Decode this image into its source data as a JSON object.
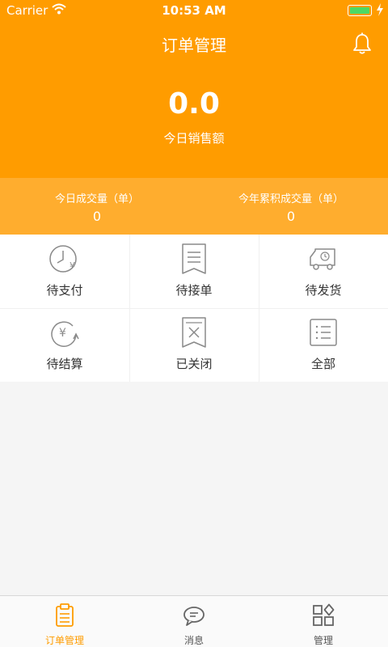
{
  "status_bar": {
    "carrier": "Carrier",
    "time": "10:53 AM"
  },
  "header": {
    "title": "订单管理",
    "amount": "0.0",
    "amount_label": "今日销售额"
  },
  "stats": {
    "today": {
      "label": "今日成交量（单）",
      "value": "0"
    },
    "year": {
      "label": "今年累积成交量（单）",
      "value": "0"
    }
  },
  "grid": {
    "items": [
      {
        "label": "待支付",
        "icon": "clock-yen-icon"
      },
      {
        "label": "待接单",
        "icon": "receipt-icon"
      },
      {
        "label": "待发货",
        "icon": "truck-icon"
      },
      {
        "label": "待结算",
        "icon": "yen-refresh-icon"
      },
      {
        "label": "已关闭",
        "icon": "closed-receipt-icon"
      },
      {
        "label": "全部",
        "icon": "list-icon"
      }
    ]
  },
  "tabbar": {
    "items": [
      {
        "label": "订单管理",
        "icon": "clipboard-icon",
        "active": true
      },
      {
        "label": "消息",
        "icon": "chat-icon",
        "active": false
      },
      {
        "label": "管理",
        "icon": "grid-diamond-icon",
        "active": false
      }
    ]
  },
  "colors": {
    "accent": "#ff9c00",
    "accent_light": "#ffad2e",
    "icon_gray": "#8a8a8a"
  }
}
